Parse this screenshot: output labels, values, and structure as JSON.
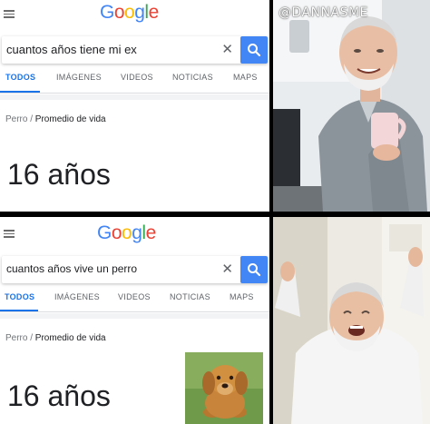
{
  "top_panel": {
    "logo": [
      "G",
      "o",
      "o",
      "g",
      "l",
      "e"
    ],
    "search_value": "cuantos años tiene mi ex",
    "tabs": [
      "TODOS",
      "IMÁGENES",
      "VIDEOS",
      "NOTICIAS",
      "MAPS"
    ],
    "breadcrumb": [
      "Perro",
      "Promedio de vida"
    ],
    "breadcrumb_sep": "/",
    "answer": "16 años"
  },
  "bottom_panel": {
    "logo": [
      "G",
      "o",
      "o",
      "g",
      "l",
      "e"
    ],
    "search_value": "cuantos años vive un perro",
    "tabs": [
      "TODOS",
      "IMÁGENES",
      "VIDEOS",
      "NOTICIAS",
      "MAPS"
    ],
    "breadcrumb": [
      "Perro",
      "Promedio de vida"
    ],
    "breadcrumb_sep": "/",
    "answer": "16 años"
  },
  "clear_symbol": "✕",
  "watermark": "@DANNASME",
  "colors": {
    "google_blue": "#4285f4",
    "google_red": "#ea4335",
    "google_yellow": "#fbbc05",
    "google_green": "#34a853",
    "active_tab": "#1a73e8"
  },
  "icons": [
    "hamburger-menu-icon",
    "clear-icon",
    "search-icon"
  ]
}
